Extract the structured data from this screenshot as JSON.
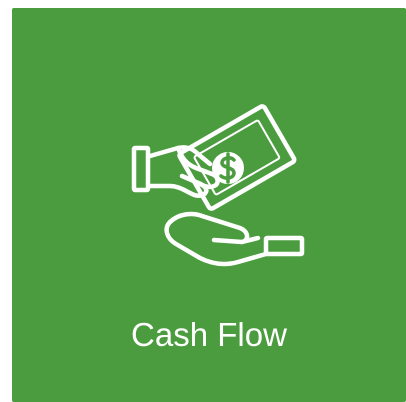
{
  "tile": {
    "label": "Cash Flow",
    "icon": "cash-flow-icon",
    "background_color": "#4a9c3e",
    "foreground_color": "#ffffff"
  }
}
